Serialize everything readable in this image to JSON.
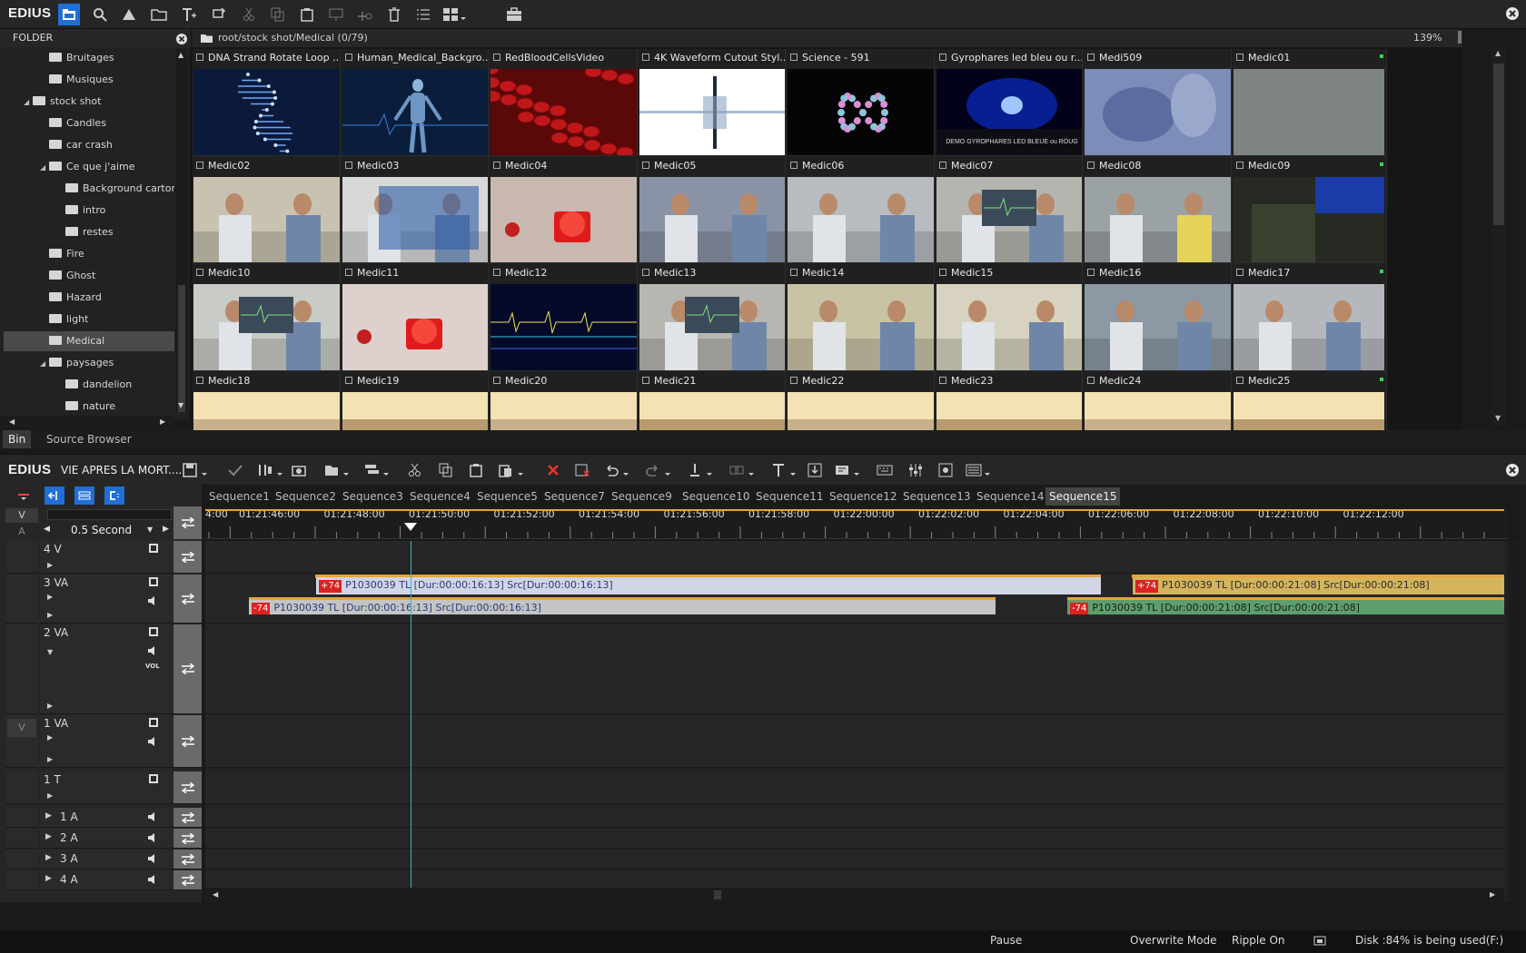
{
  "app": {
    "name": "EDIUS",
    "project_title": "VIE APRES LA MORT...."
  },
  "colors": {
    "accent": "#1f6fd6",
    "clip_blue_bar": "#d0d6e4",
    "clip_yellow_bar": "#d4b45c",
    "clip_green_bar": "#5e9e6c",
    "timeline_marker": "#e8a33a",
    "playhead": "#3bb3c9"
  },
  "bin": {
    "folder_header": "FOLDER",
    "path": "root/stock shot/Medical (0/79)",
    "zoom": "139%",
    "tabs": [
      "Bin",
      "Source Browser"
    ],
    "tree": [
      {
        "label": "Bruitages",
        "level": 2
      },
      {
        "label": "Musiques",
        "level": 2
      },
      {
        "label": "stock shot",
        "level": 1,
        "expanded": true
      },
      {
        "label": "Candles",
        "level": 2
      },
      {
        "label": "car crash",
        "level": 2
      },
      {
        "label": "Ce que j'aime",
        "level": 2,
        "expanded": true
      },
      {
        "label": "Background cartor",
        "level": 3
      },
      {
        "label": "intro",
        "level": 3
      },
      {
        "label": "restes",
        "level": 3
      },
      {
        "label": "Fire",
        "level": 2
      },
      {
        "label": "Ghost",
        "level": 2
      },
      {
        "label": "Hazard",
        "level": 2
      },
      {
        "label": "light",
        "level": 2
      },
      {
        "label": "Medical",
        "level": 2,
        "selected": true
      },
      {
        "label": "paysages",
        "level": 2,
        "expanded": true
      },
      {
        "label": "dandelion",
        "level": 3
      },
      {
        "label": "nature",
        "level": 3
      }
    ],
    "clips": [
      {
        "name": "DNA Strand Rotate Loop ...",
        "thumb": "dna"
      },
      {
        "name": "Human_Medical_Backgro...",
        "thumb": "human"
      },
      {
        "name": "RedBloodCellsVideo",
        "thumb": "blood"
      },
      {
        "name": "4K Waveform Cutout Styl...",
        "thumb": "wave"
      },
      {
        "name": "Science - 591",
        "thumb": "science"
      },
      {
        "name": "Gyrophares led bleu ou r...",
        "thumb": "gyro"
      },
      {
        "name": "Medi509",
        "thumb": "xray"
      },
      {
        "name": "Medic01",
        "thumb": "grey"
      },
      {
        "name": "Medic02",
        "thumb": "hall"
      },
      {
        "name": "Medic03",
        "thumb": "shelf"
      },
      {
        "name": "Medic04",
        "thumb": "redlight"
      },
      {
        "name": "Medic05",
        "thumb": "people"
      },
      {
        "name": "Medic06",
        "thumb": "doctor"
      },
      {
        "name": "Medic07",
        "thumb": "monitor"
      },
      {
        "name": "Medic08",
        "thumb": "surgery"
      },
      {
        "name": "Medic09",
        "thumb": "dark"
      },
      {
        "name": "Medic10",
        "thumb": "ecgmachine"
      },
      {
        "name": "Medic11",
        "thumb": "redlight2"
      },
      {
        "name": "Medic12",
        "thumb": "ecg"
      },
      {
        "name": "Medic13",
        "thumb": "desk"
      },
      {
        "name": "Medic14",
        "thumb": "room"
      },
      {
        "name": "Medic15",
        "thumb": "nurse"
      },
      {
        "name": "Medic16",
        "thumb": "patient"
      },
      {
        "name": "Medic17",
        "thumb": "ward"
      },
      {
        "name": "Medic18",
        "thumb": "warm"
      },
      {
        "name": "Medic19",
        "thumb": "warm2"
      },
      {
        "name": "Medic20",
        "thumb": "warm"
      },
      {
        "name": "Medic21",
        "thumb": "warm2"
      },
      {
        "name": "Medic22",
        "thumb": "warm"
      },
      {
        "name": "Medic23",
        "thumb": "warm2"
      },
      {
        "name": "Medic24",
        "thumb": "warm"
      },
      {
        "name": "Medic25",
        "thumb": "warm2"
      }
    ]
  },
  "timeline": {
    "sequences": [
      "Sequence1",
      "Sequence2",
      "Sequence3",
      "Sequence4",
      "Sequence5",
      "Sequence7",
      "Sequence9",
      "Sequence10",
      "Sequence11",
      "Sequence12",
      "Sequence13",
      "Sequence14",
      "Sequence15"
    ],
    "active_sequence": "Sequence15",
    "scale": "0.5 Second",
    "patch_v": "V",
    "patch_a": "A",
    "ruler": [
      "4:00",
      "01:21:46:00",
      "01:21:48:00",
      "01:21:50:00",
      "01:21:52:00",
      "01:21:54:00",
      "01:21:56:00",
      "01:21:58:00",
      "01:22:00:00",
      "01:22:02:00",
      "01:22:04:00",
      "01:22:06:00",
      "01:22:08:00",
      "01:22:10:00",
      "01:22:12:00"
    ],
    "tracks": [
      "4 V",
      "3 VA",
      "2 VA",
      "1 VA",
      "1 T",
      "1 A",
      "2 A",
      "3 A",
      "4 A"
    ],
    "vol_label": "VOL",
    "clips": [
      {
        "tag": "+74",
        "label": "P1030039  TL [Dur:00:00:16:13]  Src[Dur:00:00:16:13]",
        "kind": "video-blue"
      },
      {
        "tag": "+74",
        "label": "P1030039  TL [Dur:00:00:21:08]  Src[Dur:00:00:21:08]",
        "kind": "video-yellow"
      },
      {
        "tag": "-74",
        "label": "P1030039  TL [Dur:00:00:16:13]  Src[Dur:00:00:16:13]",
        "kind": "audio-grey"
      },
      {
        "tag": "-74",
        "label": "P1030039  TL [Dur:00:00:21:08]  Src[Dur:00:00:21:08]",
        "kind": "audio-green"
      }
    ]
  },
  "status": {
    "play": "Pause",
    "mode": "Overwrite Mode",
    "ripple": "Ripple On",
    "disk": "Disk :84% is being used(F:)"
  }
}
